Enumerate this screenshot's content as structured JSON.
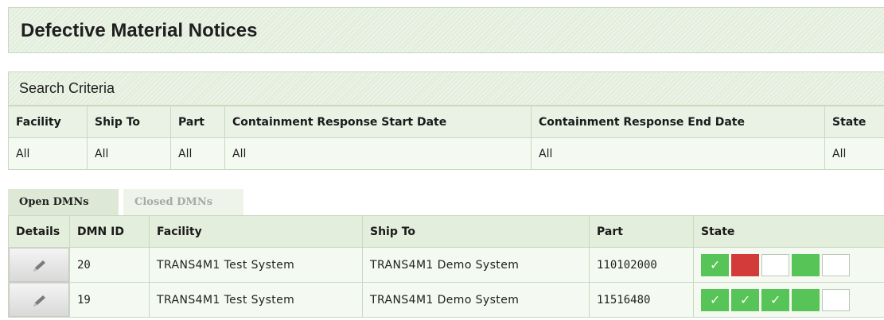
{
  "page": {
    "title": "Defective Material Notices"
  },
  "search": {
    "label": "Search Criteria",
    "columns": [
      "Facility",
      "Ship To",
      "Part",
      "Containment Response Start Date",
      "Containment Response End Date",
      "State"
    ],
    "values": [
      "All",
      "All",
      "All",
      "All",
      "All",
      "All"
    ]
  },
  "tabs": [
    {
      "label": "Open DMNs",
      "active": true
    },
    {
      "label": "Closed DMNs",
      "active": false
    }
  ],
  "dmn_table": {
    "columns": [
      "Details",
      "DMN ID",
      "Facility",
      "Ship To",
      "Part",
      "State"
    ],
    "rows": [
      {
        "id": "20",
        "facility": "TRANS4M1 Test System",
        "ship_to": "TRANS4M1 Demo System",
        "part": "110102000",
        "state": [
          "check",
          "red",
          "white",
          "green",
          "white"
        ]
      },
      {
        "id": "19",
        "facility": "TRANS4M1 Test System",
        "ship_to": "TRANS4M1 Demo System",
        "part": "11516480",
        "state": [
          "check",
          "check",
          "check",
          "green",
          "white"
        ]
      }
    ]
  },
  "icons": {
    "edit": "pencil-icon",
    "state_done": "check-icon"
  },
  "colors": {
    "state_green": "#56c456",
    "state_red": "#d33a3a",
    "accent_bg": "#e3eedd"
  }
}
